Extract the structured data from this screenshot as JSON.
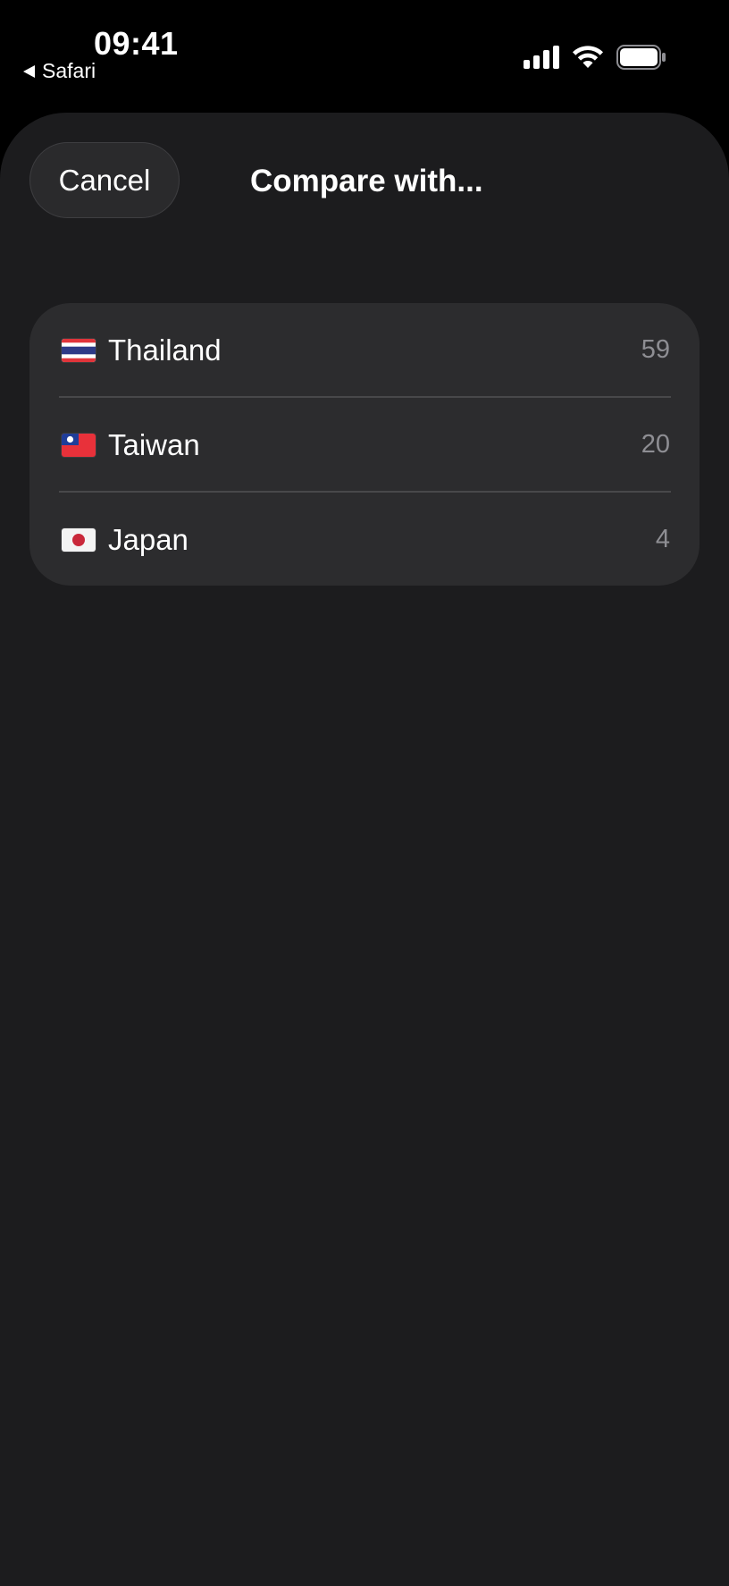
{
  "status_bar": {
    "time": "09:41",
    "back_app": "Safari",
    "icons": [
      "cellular-signal-icon",
      "wifi-icon",
      "battery-icon"
    ]
  },
  "sheet": {
    "cancel_label": "Cancel",
    "title": "Compare with..."
  },
  "countries": [
    {
      "name": "Thailand",
      "count": "59",
      "flag": "thailand-flag-icon"
    },
    {
      "name": "Taiwan",
      "count": "20",
      "flag": "taiwan-flag-icon"
    },
    {
      "name": "Japan",
      "count": "4",
      "flag": "japan-flag-icon"
    }
  ],
  "colors": {
    "background": "#000000",
    "sheet": "#1c1c1e",
    "list": "#2c2c2e",
    "secondary_text": "#8e8e93"
  }
}
